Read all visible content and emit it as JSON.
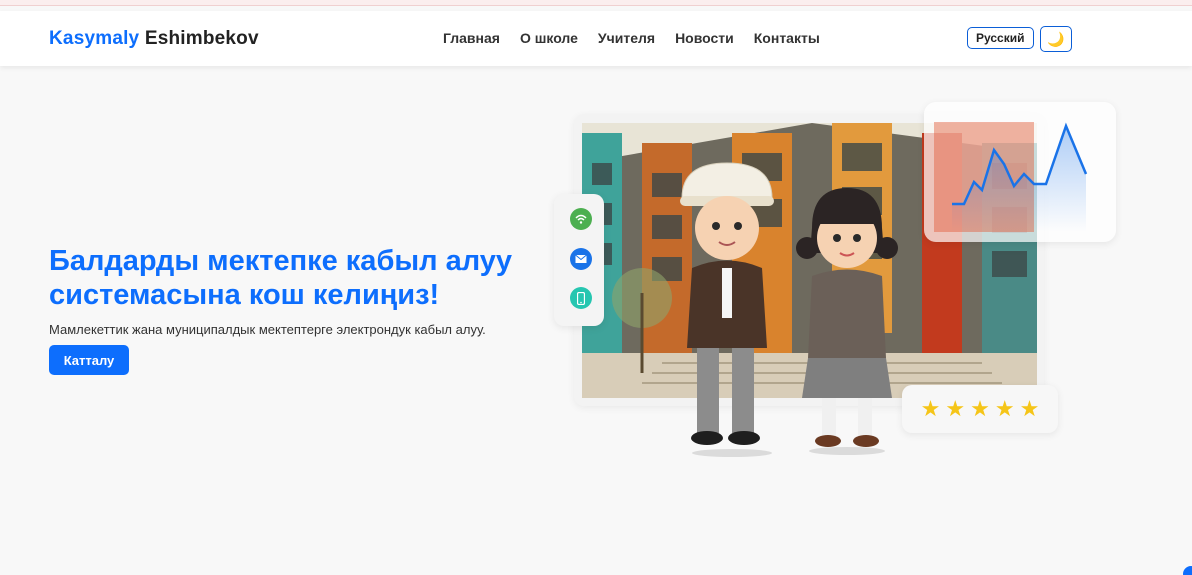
{
  "brand": {
    "part1": "Kasymaly",
    "part2": "Eshimbekov"
  },
  "nav": {
    "items": [
      "Главная",
      "О школе",
      "Учителя",
      "Новости",
      "Контакты"
    ]
  },
  "header": {
    "language": "Русский",
    "theme_icon": "moon-icon"
  },
  "hero": {
    "title": "Балдарды мектепке кабыл алуу системасына кош келиңиз!",
    "subtitle": "Мамлекеттик жана муниципалдык мектептерге электрондук кабыл алуу.",
    "cta_label": "Катталу"
  },
  "illustration": {
    "side_icons": [
      "wifi-icon",
      "mail-icon",
      "phone-icon"
    ],
    "rating_stars": 5,
    "star_char": "★"
  },
  "colors": {
    "accent": "#0d6efd",
    "star": "#f5c518",
    "wifi": "#4caf50",
    "mail": "#1a73e8",
    "phone": "#26c6b0"
  }
}
